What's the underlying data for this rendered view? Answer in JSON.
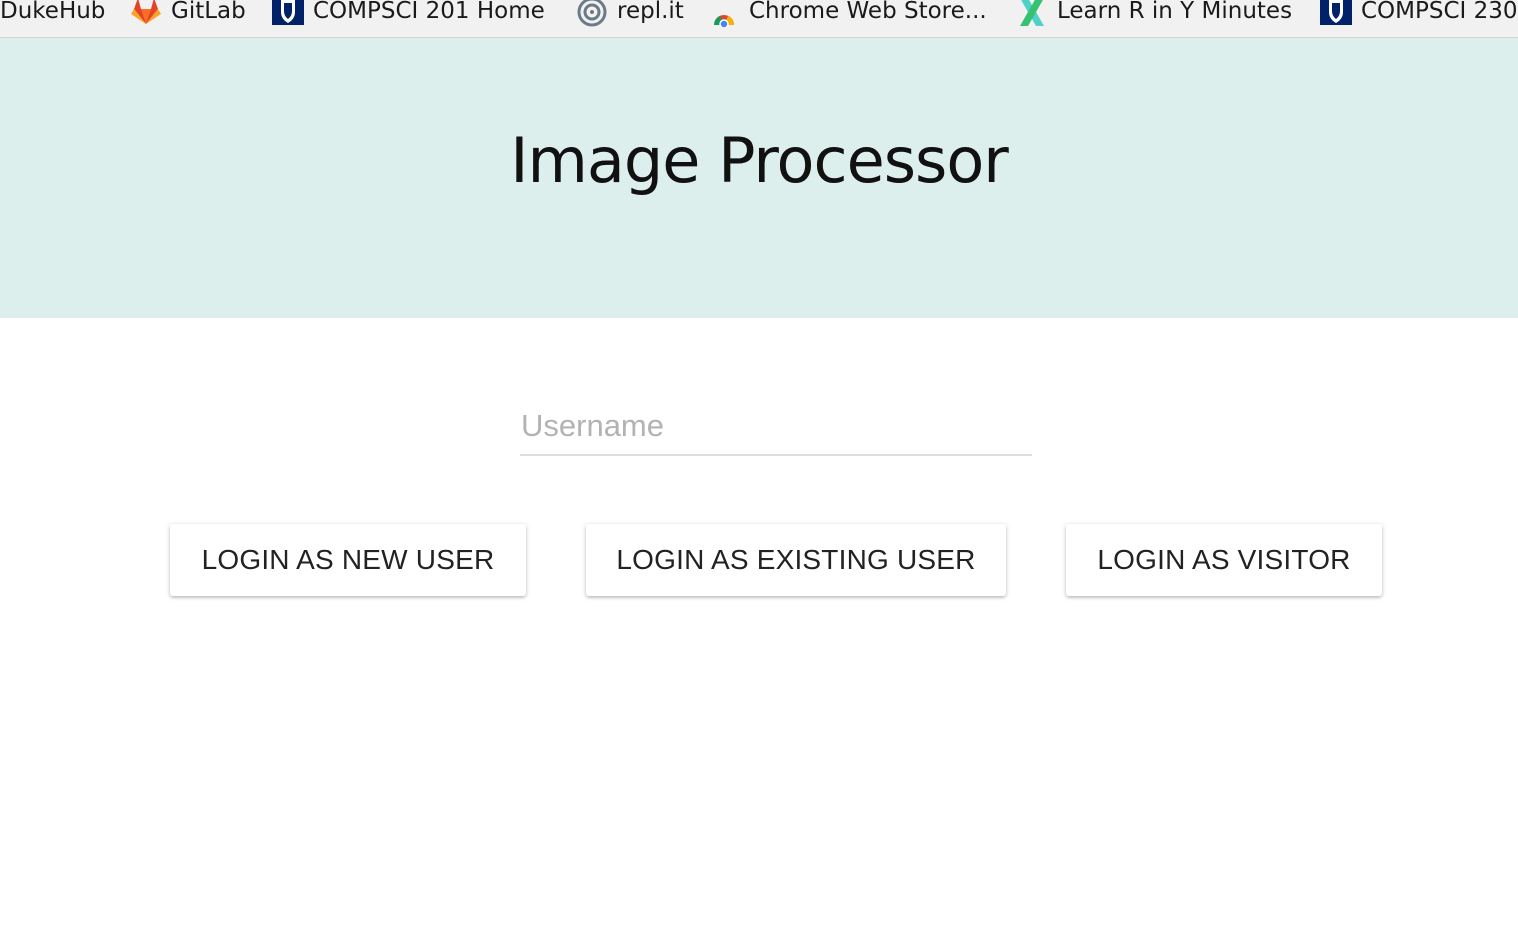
{
  "bookmarks": [
    {
      "label": "DukeHub",
      "icon": "none"
    },
    {
      "label": "GitLab",
      "icon": "gitlab-fox-icon"
    },
    {
      "label": "COMPSCI 201 Home",
      "icon": "duke-shield-icon"
    },
    {
      "label": "repl.it",
      "icon": "replit-swirl-icon"
    },
    {
      "label": "Chrome Web Store...",
      "icon": "chrome-web-store-icon"
    },
    {
      "label": "Learn R in Y Minutes",
      "icon": "learn-x-icon"
    },
    {
      "label": "COMPSCI 230",
      "icon": "duke-shield-icon"
    }
  ],
  "header": {
    "title": "Image Processor",
    "background": "#ddefed"
  },
  "login": {
    "username_placeholder": "Username",
    "username_value": "",
    "buttons": {
      "new_user": "LOGIN AS NEW USER",
      "existing_user": "LOGIN AS EXISTING USER",
      "visitor": "LOGIN AS VISITOR"
    }
  }
}
